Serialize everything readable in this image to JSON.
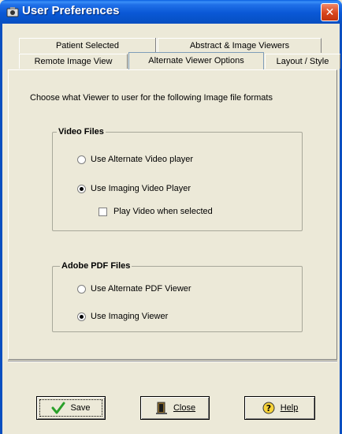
{
  "window": {
    "title": "User Preferences"
  },
  "tabs": {
    "back_row": [
      "Patient Selected",
      "Abstract & Image Viewers"
    ],
    "front_row": [
      "Remote Image View",
      "Alternate Viewer Options",
      "Layout / Style"
    ],
    "active": "Alternate Viewer Options"
  },
  "content": {
    "instruction": "Choose what Viewer to user for the following Image file formats",
    "video_group": {
      "title": "Video Files",
      "options": [
        {
          "label": "Use Alternate Video player",
          "selected": false
        },
        {
          "label": "Use Imaging Video Player",
          "selected": true
        }
      ],
      "checkbox": {
        "label": "Play Video when selected",
        "checked": false
      }
    },
    "pdf_group": {
      "title": "Adobe PDF Files",
      "options": [
        {
          "label": "Use Alternate PDF Viewer",
          "selected": false
        },
        {
          "label": "Use Imaging Viewer",
          "selected": true
        }
      ]
    }
  },
  "buttons": {
    "save": "Save",
    "close": "Close",
    "help": "Help"
  },
  "icons": {
    "title": "app-camera-icon",
    "close": "close-icon",
    "save": "checkmark-icon",
    "close_btn": "door-exit-icon",
    "help": "help-question-icon"
  },
  "colors": {
    "titlebar": "#0a58d6",
    "window_bg": "#ece9d8",
    "close_button": "#d9451c",
    "check_green": "#2aa02a"
  }
}
